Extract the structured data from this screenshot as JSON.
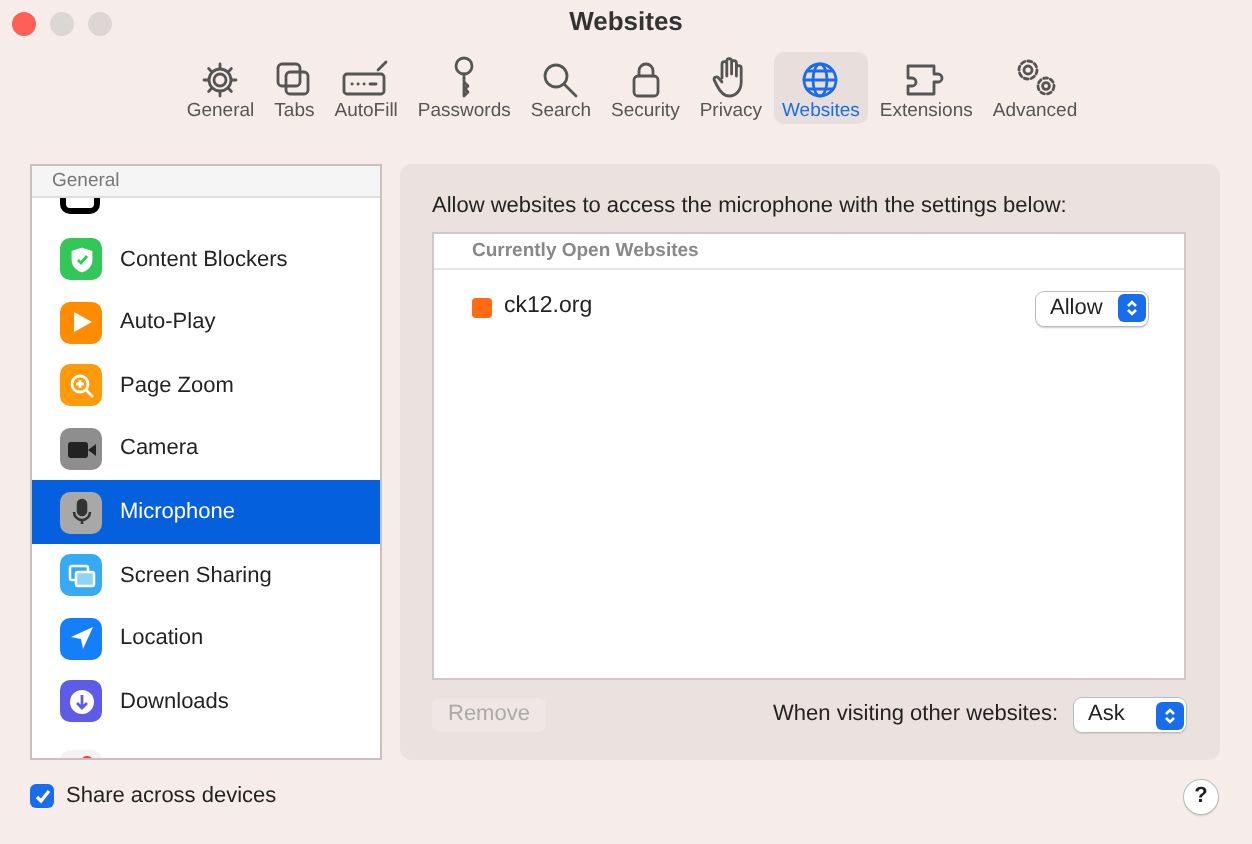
{
  "window": {
    "title": "Websites"
  },
  "toolbar": [
    {
      "label": "General",
      "selected": false
    },
    {
      "label": "Tabs",
      "selected": false
    },
    {
      "label": "AutoFill",
      "selected": false
    },
    {
      "label": "Passwords",
      "selected": false
    },
    {
      "label": "Search",
      "selected": false
    },
    {
      "label": "Security",
      "selected": false
    },
    {
      "label": "Privacy",
      "selected": false
    },
    {
      "label": "Websites",
      "selected": true
    },
    {
      "label": "Extensions",
      "selected": false
    },
    {
      "label": "Advanced",
      "selected": false
    }
  ],
  "sidebar": {
    "header": "General",
    "items": [
      {
        "label": "Content Blockers",
        "selected": false
      },
      {
        "label": "Auto-Play",
        "selected": false
      },
      {
        "label": "Page Zoom",
        "selected": false
      },
      {
        "label": "Camera",
        "selected": false
      },
      {
        "label": "Microphone",
        "selected": true
      },
      {
        "label": "Screen Sharing",
        "selected": false
      },
      {
        "label": "Location",
        "selected": false
      },
      {
        "label": "Downloads",
        "selected": false
      }
    ]
  },
  "panel": {
    "description": "Allow websites to access the microphone with the settings below:",
    "table": {
      "header": "Currently Open Websites",
      "rows": [
        {
          "site": "ck12.org",
          "setting": "Allow"
        }
      ]
    },
    "remove_button": {
      "label": "Remove",
      "disabled": true
    },
    "other_label": "When visiting other websites:",
    "other_setting": "Ask"
  },
  "footer": {
    "share": {
      "label": "Share across devices",
      "checked": true
    },
    "help": "?"
  }
}
